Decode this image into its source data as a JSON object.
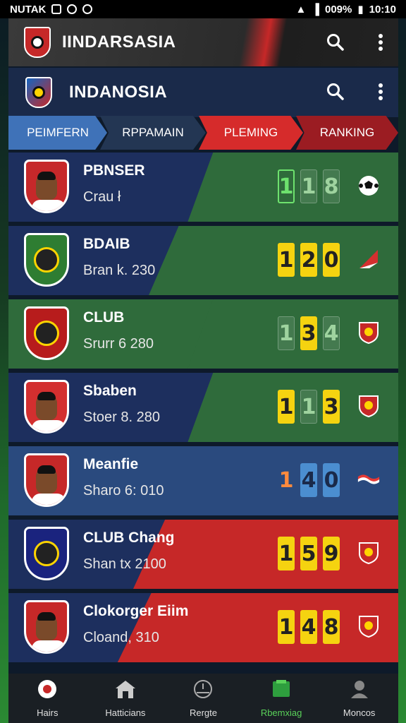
{
  "status_bar": {
    "left_text": "NUTAK",
    "battery": "009%",
    "time": "10:10"
  },
  "top_bar": {
    "title": "IINDARSASIA"
  },
  "sub_bar": {
    "title": "INDANOSIA"
  },
  "tabs": [
    {
      "label": "PEIMFERN",
      "color": "#3f72b8"
    },
    {
      "label": "RPPAMAIN",
      "color": "#233653"
    },
    {
      "label": "PLEMING",
      "color": "#d62b2b"
    },
    {
      "label": "RANKING",
      "color": "#9b1c22"
    }
  ],
  "cards": [
    {
      "name": "PBNSER",
      "sub": "Crau ł",
      "digits": [
        "1",
        "1",
        "8"
      ],
      "left": "#1d2f5e",
      "right": "#2f6b3b",
      "badge": "player",
      "badge_bg": "#c6282a",
      "digit_style": [
        "neon",
        "dim",
        "dim"
      ],
      "icon": "soccer-ball-icon"
    },
    {
      "name": "BDAIB",
      "sub": "Bran k. 230",
      "digits": [
        "1",
        "2",
        "0"
      ],
      "left": "#1d2f5e",
      "right": "#2f6b3b",
      "badge": "emblem",
      "badge_bg": "#2e7d32",
      "digit_style": [
        "yellow",
        "yellow",
        "yellow"
      ],
      "icon": "flag-icon"
    },
    {
      "name": "CLUB",
      "sub": "Srurr 6 280",
      "digits": [
        "1",
        "3",
        "4"
      ],
      "left": "#2f6b3b",
      "right": "#2f6b3b",
      "badge": "emblem",
      "badge_bg": "#b71c1c",
      "digit_style": [
        "dim",
        "yellow",
        "dim"
      ],
      "icon": "shield-icon"
    },
    {
      "name": "Sbaben",
      "sub": "Stoer 8. 280",
      "digits": [
        "1",
        "1",
        "3"
      ],
      "left": "#1d2f5e",
      "right": "#2f6b3b",
      "badge": "player",
      "badge_bg": "#d32f2f",
      "digit_style": [
        "yellow",
        "dim",
        "yellow"
      ],
      "icon": "crest-icon"
    },
    {
      "name": "Meanfie",
      "sub": "Sharo 6: 010",
      "digits": [
        "1",
        "4",
        "0"
      ],
      "left": "#2a4a7e",
      "right": "#2a4a7e",
      "badge": "player",
      "badge_bg": "#c62828",
      "digit_style": [
        "orange",
        "blue",
        "blue"
      ],
      "icon": "flag-wave-icon"
    },
    {
      "name": "CLUB Chang",
      "sub": "Shan tx 2100",
      "digits": [
        "1",
        "5",
        "9"
      ],
      "left": "#1d2f5e",
      "right": "#c62828",
      "badge": "emblem",
      "badge_bg": "#1a237e",
      "digit_style": [
        "yellow",
        "yellow",
        "yellow"
      ],
      "icon": "shield-icon"
    },
    {
      "name": "Clokorger Eiim",
      "sub": "Cloand, 310",
      "digits": [
        "1",
        "4",
        "8"
      ],
      "left": "#1d2f5e",
      "right": "#c62828",
      "badge": "player",
      "badge_bg": "#c62828",
      "digit_style": [
        "yellow",
        "yellow",
        "yellow"
      ],
      "icon": "crest-icon"
    }
  ],
  "bottom_nav": [
    {
      "label": "Hairs",
      "icon": "home-icon"
    },
    {
      "label": "Hatticians",
      "icon": "stadium-icon"
    },
    {
      "label": "Rergte",
      "icon": "clock-icon"
    },
    {
      "label": "Rbemxiag",
      "icon": "ranking-icon",
      "active": true
    },
    {
      "label": "Moncos",
      "icon": "profile-icon"
    }
  ]
}
